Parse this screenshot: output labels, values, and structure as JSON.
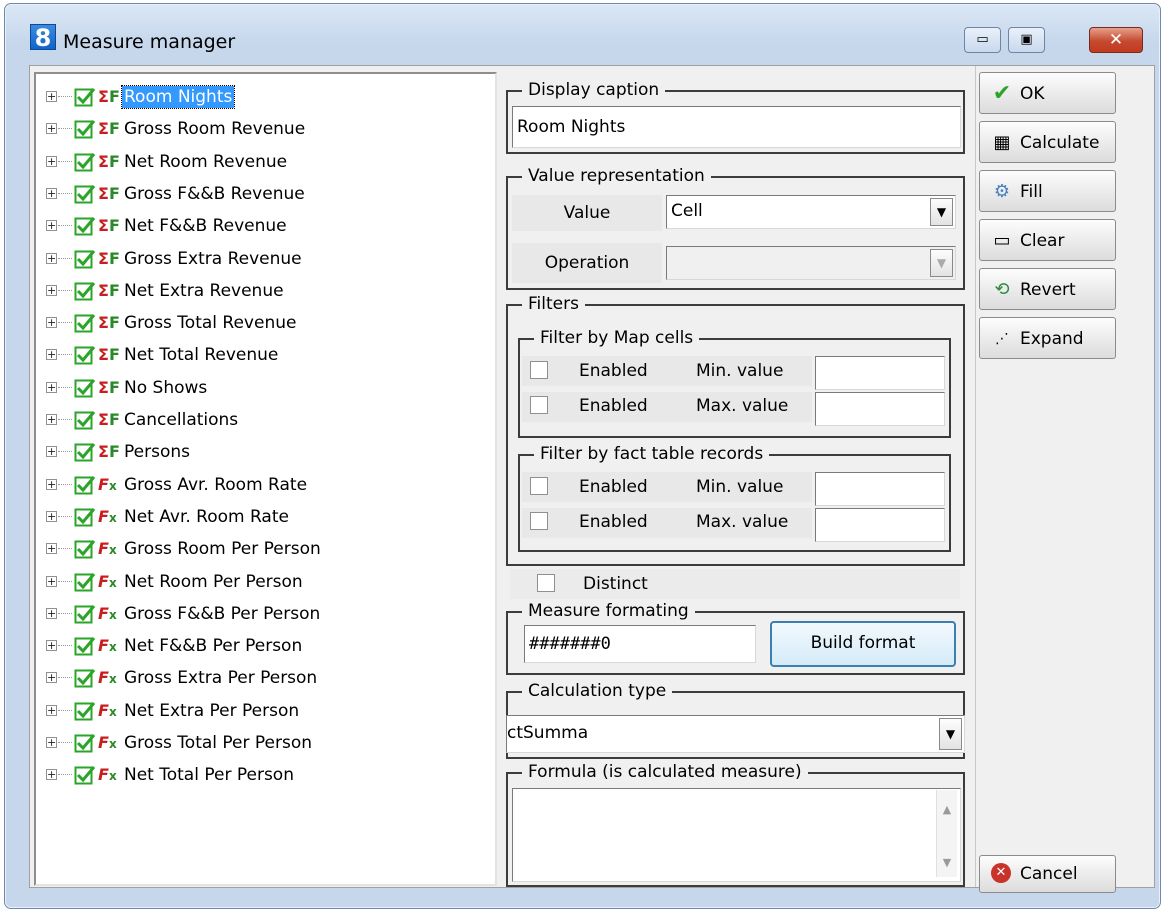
{
  "window": {
    "icon_text": "8",
    "title": "Measure manager",
    "minimize_glyph": "▭",
    "restore_glyph": "▣",
    "close_glyph": "✕"
  },
  "tree": {
    "items": [
      {
        "label": "Room Nights",
        "icon": "sigma-icon",
        "selected": true
      },
      {
        "label": "Gross Room Revenue",
        "icon": "sigma-icon"
      },
      {
        "label": "Net Room Revenue",
        "icon": "sigma-icon"
      },
      {
        "label": "Gross F&&B Revenue",
        "icon": "sigma-icon"
      },
      {
        "label": "Net F&&B Revenue",
        "icon": "sigma-icon"
      },
      {
        "label": "Gross Extra Revenue",
        "icon": "sigma-icon"
      },
      {
        "label": "Net Extra Revenue",
        "icon": "sigma-icon"
      },
      {
        "label": "Gross Total Revenue",
        "icon": "sigma-icon"
      },
      {
        "label": "Net Total Revenue",
        "icon": "sigma-icon"
      },
      {
        "label": "No Shows",
        "icon": "sigma-icon"
      },
      {
        "label": "Cancellations",
        "icon": "sigma-icon"
      },
      {
        "label": "Persons",
        "icon": "sigma-icon"
      },
      {
        "label": "Gross Avr. Room Rate",
        "icon": "formula-icon"
      },
      {
        "label": "Net Avr. Room Rate",
        "icon": "formula-icon"
      },
      {
        "label": "Gross Room Per Person",
        "icon": "formula-icon"
      },
      {
        "label": "Net Room Per Person",
        "icon": "formula-icon"
      },
      {
        "label": "Gross F&&B Per Person",
        "icon": "formula-icon"
      },
      {
        "label": "Net F&&B Per Person",
        "icon": "formula-icon"
      },
      {
        "label": "Gross Extra Per Person",
        "icon": "formula-icon"
      },
      {
        "label": "Net Extra Per Person",
        "icon": "formula-icon"
      },
      {
        "label": "Gross Total Per Person",
        "icon": "formula-icon"
      },
      {
        "label": "Net Total Per Person",
        "icon": "formula-icon"
      }
    ]
  },
  "display_caption": {
    "title": "Display caption",
    "value": "Room Nights"
  },
  "value_representation": {
    "title": "Value representation",
    "value_label": "Value",
    "value_selected": "Cell",
    "operation_label": "Operation",
    "operation_selected": ""
  },
  "filters": {
    "title": "Filters",
    "map_cells": {
      "title": "Filter by Map cells",
      "row1": {
        "enabled_label": "Enabled",
        "limit_label": "Min. value",
        "value": ""
      },
      "row2": {
        "enabled_label": "Enabled",
        "limit_label": "Max. value",
        "value": ""
      }
    },
    "fact_table": {
      "title": "Filter by fact table records",
      "row1": {
        "enabled_label": "Enabled",
        "limit_label": "Min. value",
        "value": ""
      },
      "row2": {
        "enabled_label": "Enabled",
        "limit_label": "Max. value",
        "value": ""
      }
    }
  },
  "distinct": {
    "label": "Distinct"
  },
  "measure_formating": {
    "title": "Measure formating",
    "format_value": "#######0",
    "build_label": "Build format"
  },
  "calculation_type": {
    "title": "Calculation type",
    "selected": "ctSumma"
  },
  "formula": {
    "title": "Formula (is calculated measure)",
    "value": ""
  },
  "actions": {
    "ok": "OK",
    "calculate": "Calculate",
    "fill": "Fill",
    "clear": "Clear",
    "revert": "Revert",
    "expand": "Expand",
    "cancel": "Cancel"
  },
  "colors": {
    "selection": "#3399ff",
    "check_green": "#2aa52a",
    "measure_red": "#c81e1e"
  }
}
